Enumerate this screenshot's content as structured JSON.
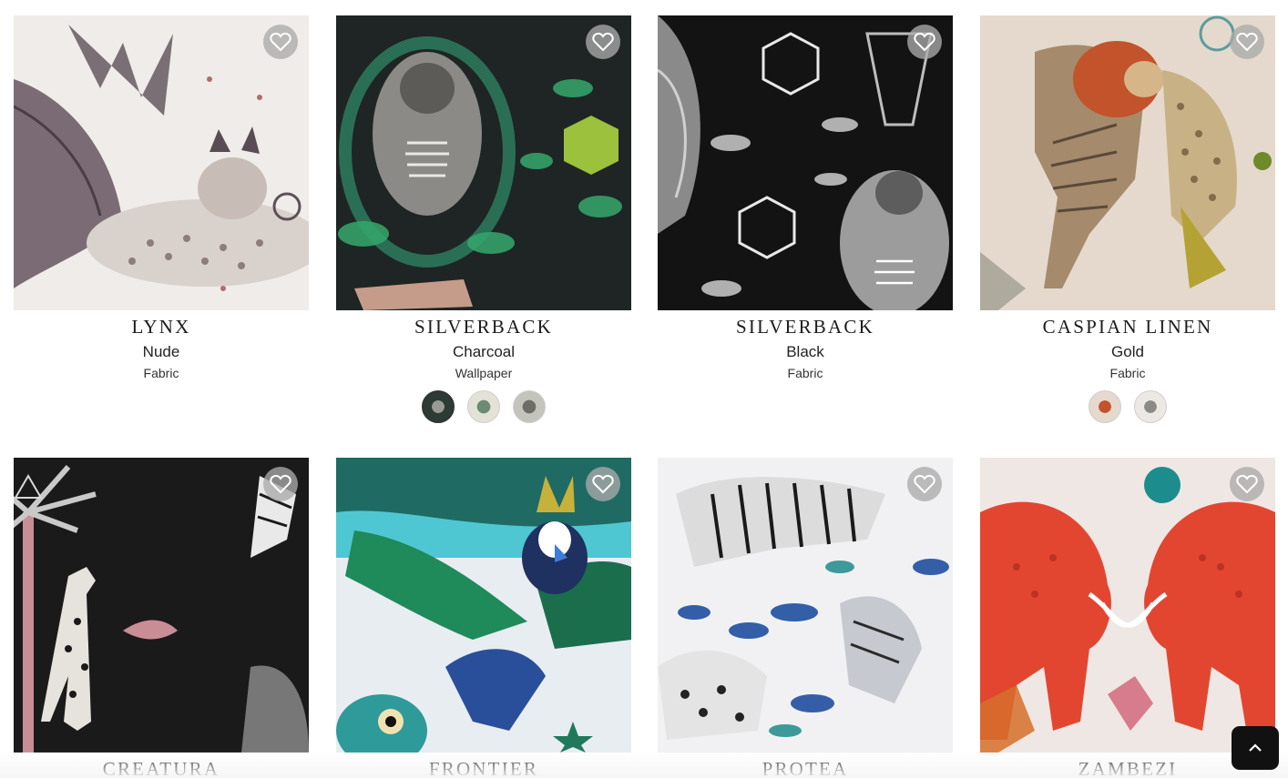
{
  "products": [
    {
      "title": "LYNX",
      "color": "Nude",
      "type": "Fabric",
      "swatches": []
    },
    {
      "title": "SILVERBACK",
      "color": "Charcoal",
      "type": "Wallpaper",
      "swatches": [
        "#2d3b35",
        "#c9c9bb",
        "#9a9a94"
      ]
    },
    {
      "title": "SILVERBACK",
      "color": "Black",
      "type": "Fabric",
      "swatches": []
    },
    {
      "title": "CASPIAN LINEN",
      "color": "Gold",
      "type": "Fabric",
      "swatches": [
        "#c9a27a",
        "#cfcac4"
      ]
    },
    {
      "title": "CREATURA",
      "color": "",
      "type": "",
      "swatches": []
    },
    {
      "title": "FRONTIER",
      "color": "",
      "type": "",
      "swatches": []
    },
    {
      "title": "PROTEA",
      "color": "",
      "type": "",
      "swatches": []
    },
    {
      "title": "ZAMBEZI",
      "color": "",
      "type": "",
      "swatches": []
    }
  ],
  "icons": {
    "favorite": "heart-outline-icon",
    "back_to_top": "chevron-up-icon"
  },
  "colors": {
    "fav_bg": "#aaaaaa",
    "back_to_top_bg": "#111111"
  }
}
